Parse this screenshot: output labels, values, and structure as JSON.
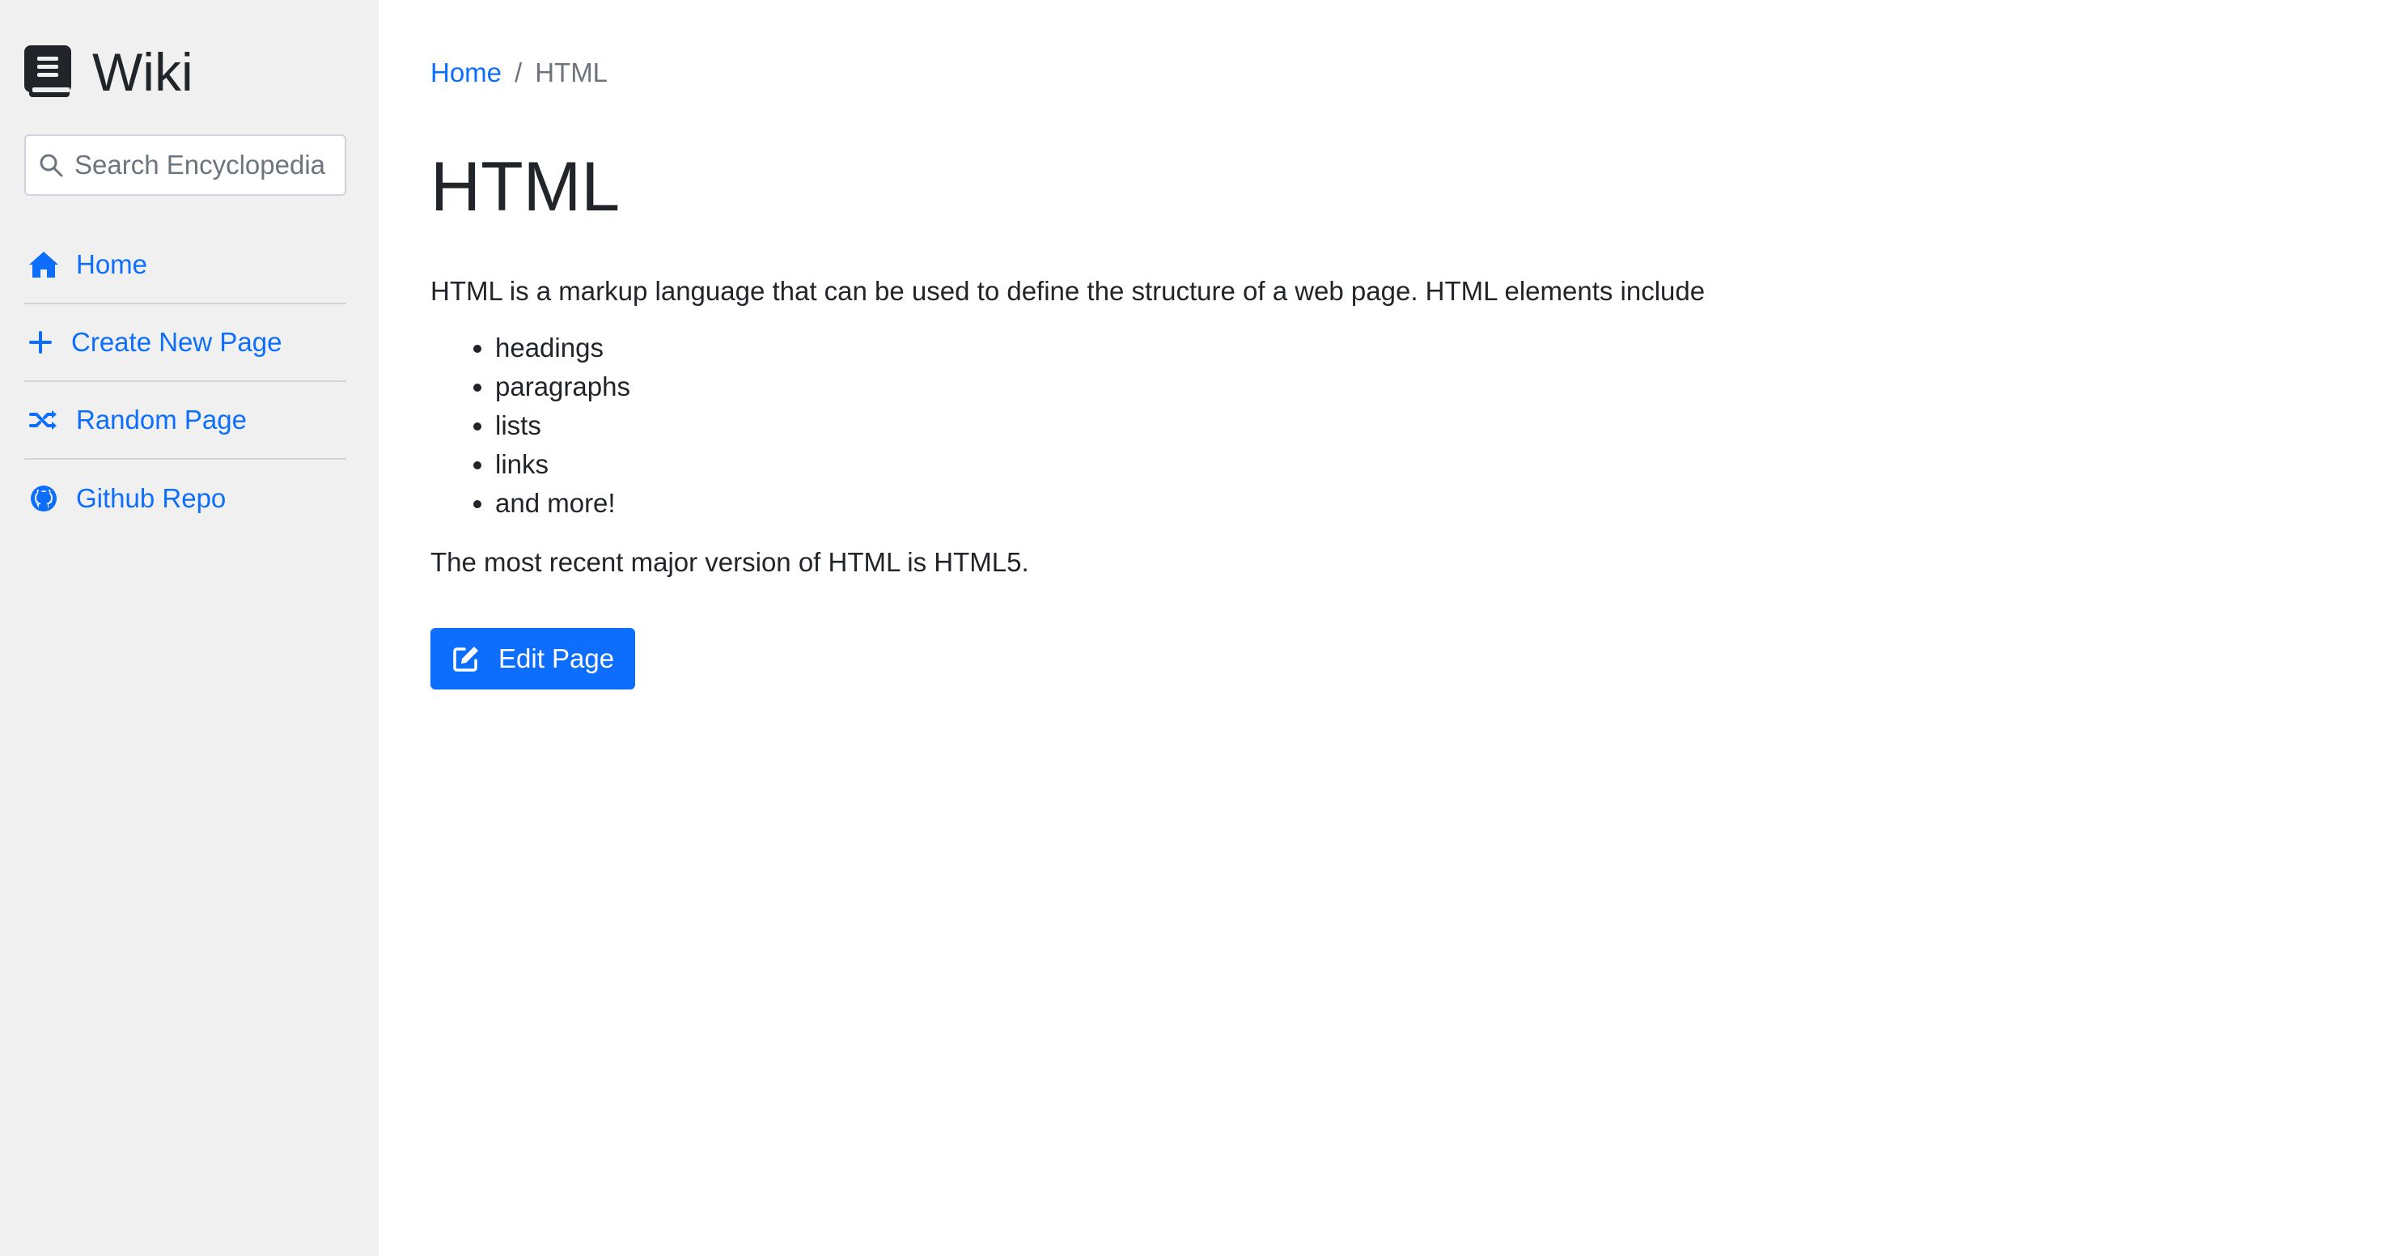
{
  "sidebar": {
    "brand": {
      "title": "Wiki",
      "icon": "book-icon"
    },
    "search": {
      "placeholder": "Search Encyclopedia",
      "icon": "search-icon"
    },
    "nav": [
      {
        "label": "Home",
        "icon": "home-icon"
      },
      {
        "label": "Create New Page",
        "icon": "plus-icon"
      },
      {
        "label": "Random Page",
        "icon": "shuffle-icon"
      },
      {
        "label": "Github Repo",
        "icon": "github-icon"
      }
    ]
  },
  "breadcrumb": {
    "home": "Home",
    "separator": "/",
    "current": "HTML"
  },
  "article": {
    "title": "HTML",
    "intro": "HTML is a markup language that can be used to define the structure of a web page. HTML elements include",
    "items": [
      "headings",
      "paragraphs",
      "lists",
      "links",
      "and more!"
    ],
    "outro": "The most recent major version of HTML is HTML5."
  },
  "actions": {
    "edit_label": "Edit Page",
    "edit_icon": "edit-icon"
  },
  "colors": {
    "accent": "#0d6efd",
    "sidebar_bg": "#f0f0f0",
    "text": "#212529",
    "muted": "#6c757d"
  }
}
